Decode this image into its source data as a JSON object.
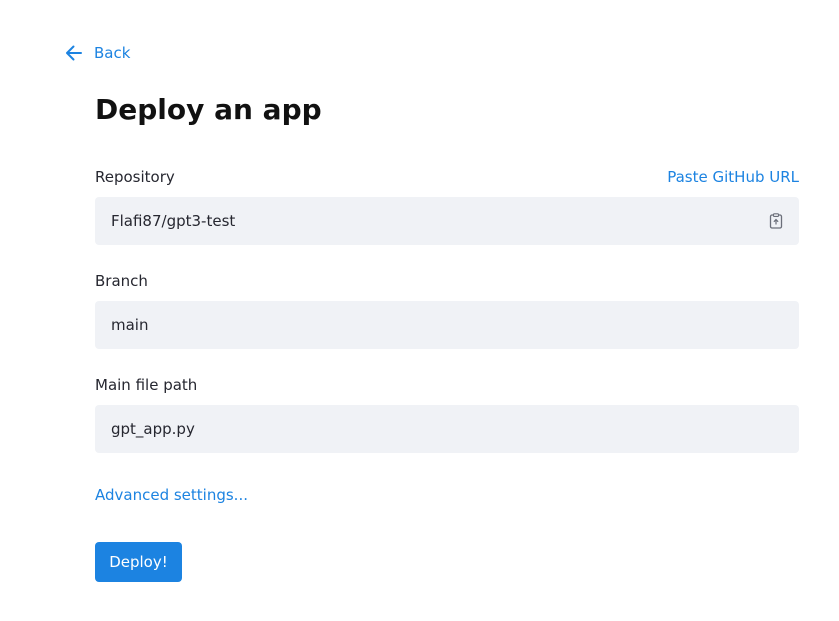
{
  "nav": {
    "back_label": "Back",
    "back_icon": "arrow-left-icon"
  },
  "page": {
    "title": "Deploy an app"
  },
  "form": {
    "repository": {
      "label": "Repository",
      "link": "Paste GitHub URL",
      "value": "Flafi87/gpt3-test",
      "icon": "clipboard-icon"
    },
    "branch": {
      "label": "Branch",
      "value": "main"
    },
    "main_file": {
      "label": "Main file path",
      "value": "gpt_app.py"
    },
    "advanced_label": "Advanced settings...",
    "deploy_label": "Deploy!"
  },
  "colors": {
    "accent": "#1c83e1",
    "input_bg": "#f0f2f6",
    "text": "#262730"
  }
}
